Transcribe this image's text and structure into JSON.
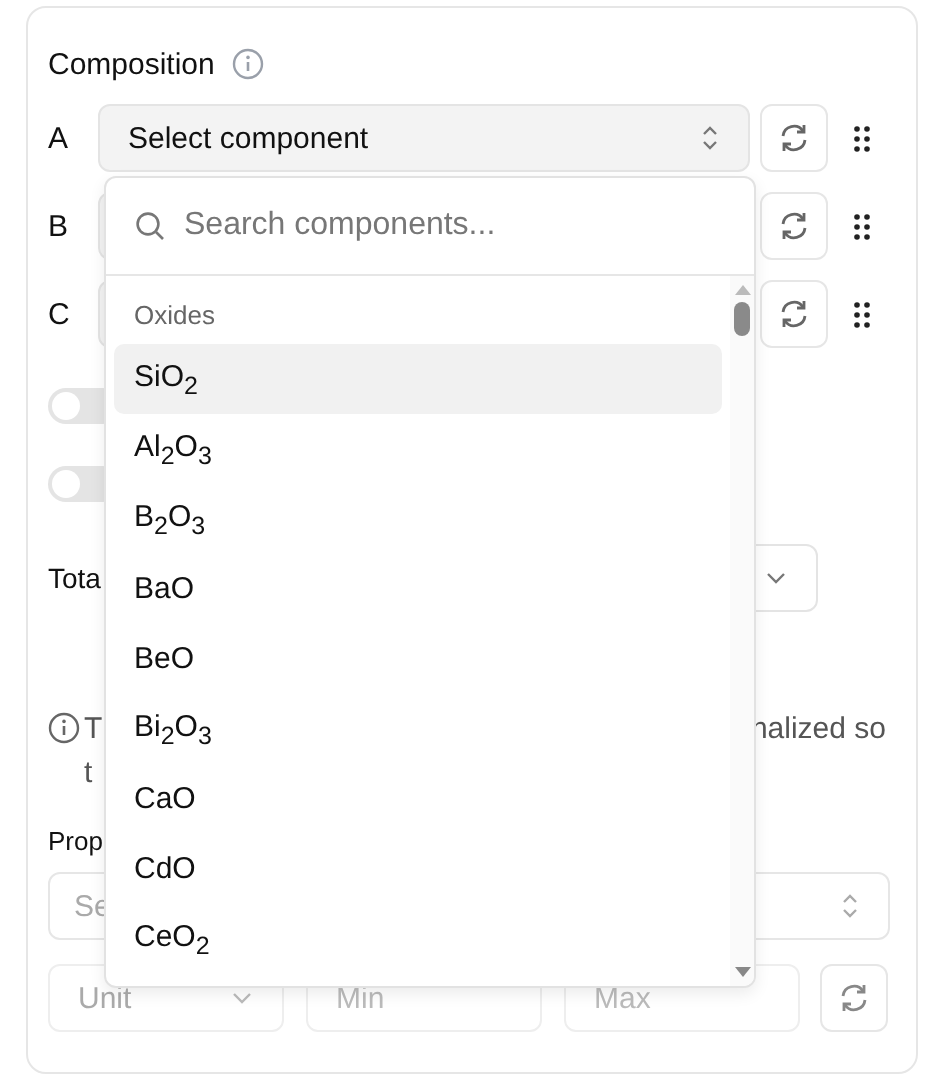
{
  "composition": {
    "title": "Composition",
    "rows": [
      {
        "label": "A",
        "placeholder": "Select component"
      },
      {
        "label": "B"
      },
      {
        "label": "C"
      }
    ]
  },
  "toggles": [
    {
      "on": false
    },
    {
      "on": false
    }
  ],
  "total": {
    "label": "Tota"
  },
  "note": {
    "line1_start": "T",
    "line1_end": "nalized so",
    "line2": "t"
  },
  "properties": {
    "label": "Prop",
    "select_placeholder": "Se",
    "unit_placeholder": "Unit",
    "min_placeholder": "Min",
    "max_placeholder": "Max"
  },
  "dropdown": {
    "search_placeholder": "Search components...",
    "group": "Oxides",
    "items": [
      {
        "label": "SiO$_{2}$",
        "selected": true
      },
      {
        "label": "Al$_{2}$O$_{3}$",
        "selected": false
      },
      {
        "label": "B$_{2}$O$_{3}$",
        "selected": false
      },
      {
        "label": "BaO",
        "selected": false
      },
      {
        "label": "BeO",
        "selected": false
      },
      {
        "label": "Bi$_{2}$O$_{3}$",
        "selected": false
      },
      {
        "label": "CaO",
        "selected": false
      },
      {
        "label": "CdO",
        "selected": false
      },
      {
        "label": "CeO$_{2}$",
        "selected": false
      }
    ]
  }
}
